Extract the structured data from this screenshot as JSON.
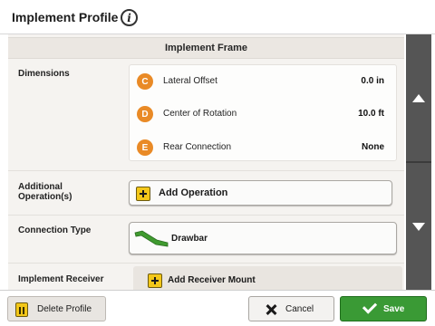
{
  "header": {
    "title": "Implement Profile",
    "info_glyph": "i"
  },
  "section": {
    "title": "Implement Frame"
  },
  "labels": {
    "dimensions": "Dimensions",
    "additional_operations": "Additional\nOperation(s)",
    "connection_type": "Connection Type",
    "implement_receiver": "Implement Receiver"
  },
  "dimensions": [
    {
      "badge": "C",
      "label": "Lateral Offset",
      "value": "0.0 in"
    },
    {
      "badge": "D",
      "label": "Center of Rotation",
      "value": "10.0 ft"
    },
    {
      "badge": "E",
      "label": "Rear Connection",
      "value": "None"
    }
  ],
  "add_operation": {
    "label": "Add Operation"
  },
  "connection": {
    "label": "Drawbar",
    "icon": "drawbar-icon"
  },
  "receiver": {
    "label": "Add Receiver Mount"
  },
  "footer": {
    "delete_label": "Delete Profile",
    "cancel_label": "Cancel",
    "save_label": "Save"
  },
  "colors": {
    "badge": "#e98a26",
    "plus_yellow": "#f3c719",
    "save_green": "#3a9a35",
    "scroll_bg": "#555555"
  }
}
